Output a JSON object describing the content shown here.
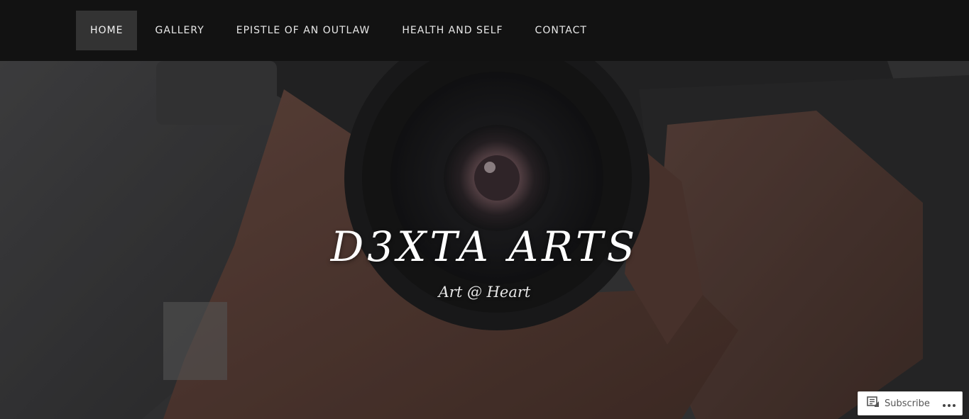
{
  "nav": {
    "items": [
      {
        "label": "HOME",
        "active": true
      },
      {
        "label": "GALLERY",
        "active": false
      },
      {
        "label": "EPISTLE OF AN OUTLAW",
        "active": false
      },
      {
        "label": "HEALTH AND SELF",
        "active": false
      },
      {
        "label": "CONTACT",
        "active": false
      }
    ]
  },
  "hero": {
    "title": "D3XTA ARTS",
    "tagline": "Art @ Heart",
    "background_image": "camera-photo"
  },
  "subscribe_bar": {
    "subscribe_label": "Subscribe",
    "subscribe_icon": "reader-icon",
    "more_icon": "ellipsis-icon"
  },
  "colors": {
    "nav_background": "#121212",
    "nav_active_background": "#333333",
    "title_color": "#ffffff"
  }
}
